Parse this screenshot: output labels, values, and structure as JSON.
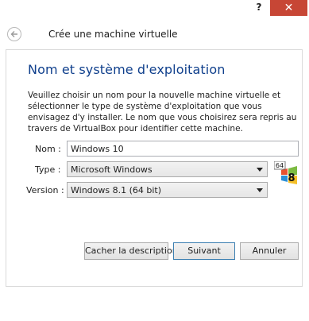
{
  "titlebar": {
    "help_label": "?",
    "close_label": "✕"
  },
  "header": {
    "title": "Crée une machine virtuelle"
  },
  "page": {
    "title": "Nom et système d'exploitation",
    "description": "Veuillez choisir un nom pour la nouvelle machine virtuelle et sélectionner le type de système d'exploitation que vous envisagez d'y installer. Le nom que vous choisirez sera repris au travers de VirtualBox pour identifier cette machine."
  },
  "form": {
    "name_label": "Nom :",
    "name_value": "Windows 10",
    "type_label": "Type :",
    "type_value": "Microsoft Windows",
    "version_label": "Version :",
    "version_value": "Windows 8.1 (64 bit)"
  },
  "os_icon": {
    "badge": "64",
    "digit": "8"
  },
  "buttons": {
    "description_label": "Cacher la description",
    "next_label": "Suivant",
    "cancel_label": "Annuler"
  },
  "colors": {
    "title_blue": "#0f3f8c",
    "close_red": "#c74635",
    "primary_border": "#3c7fb1"
  },
  "icons": [
    "help-icon",
    "close-icon",
    "back-arrow-icon",
    "dropdown-arrow-icon",
    "os-windows-64-icon"
  ]
}
